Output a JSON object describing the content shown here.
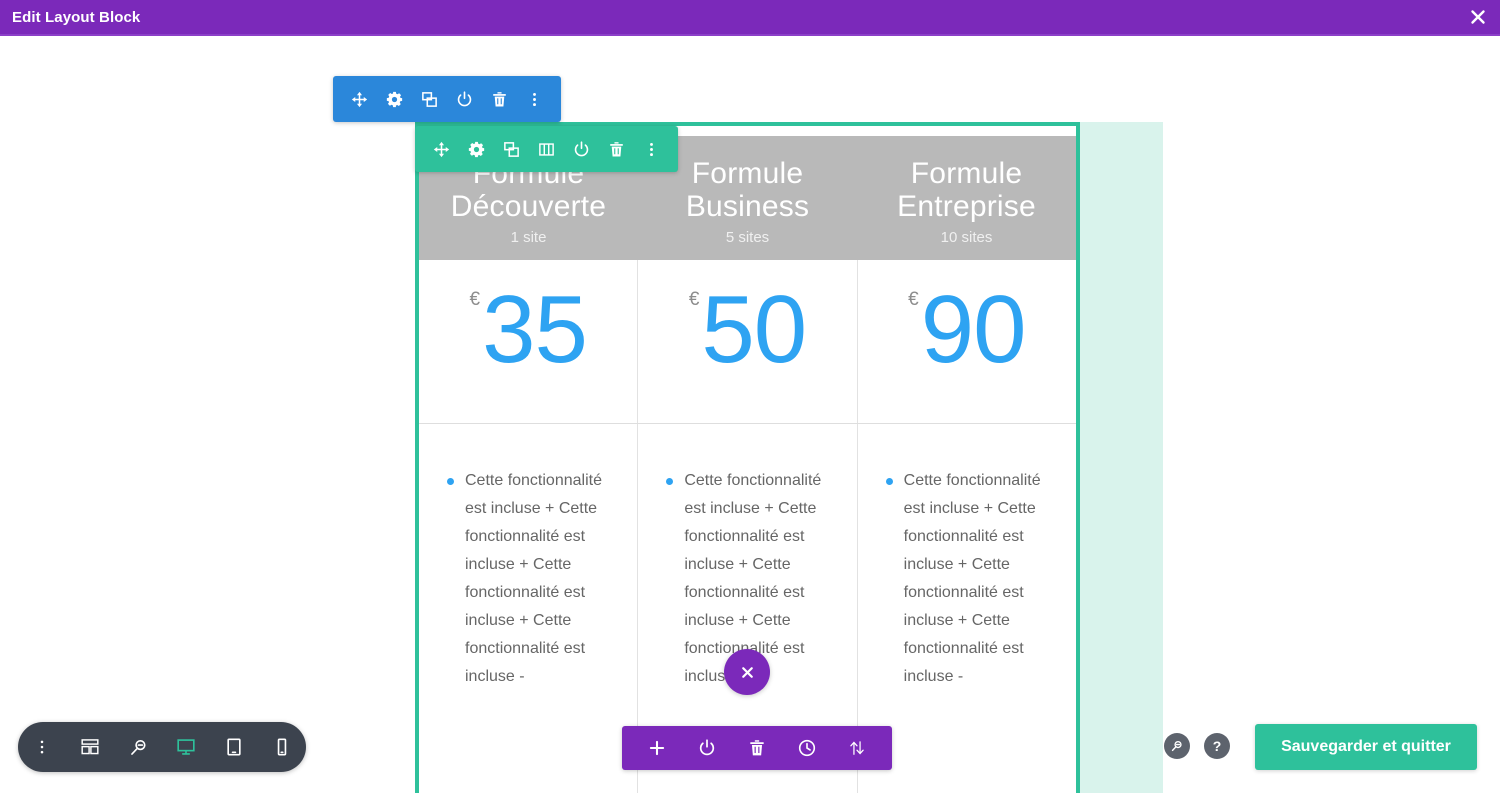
{
  "window": {
    "title": "Edit Layout Block",
    "close_icon": "close-icon",
    "accent": "#7b29ba"
  },
  "row_toolbar": {
    "color": "#2b87da",
    "buttons": [
      {
        "icon": "move-icon",
        "label": "Move row"
      },
      {
        "icon": "gear-icon",
        "label": "Row settings"
      },
      {
        "icon": "duplicate-icon",
        "label": "Duplicate row"
      },
      {
        "icon": "power-icon",
        "label": "Disable row"
      },
      {
        "icon": "trash-icon",
        "label": "Delete row"
      },
      {
        "icon": "more-vertical-icon",
        "label": "More options"
      }
    ]
  },
  "column_toolbar": {
    "color": "#2ec19b",
    "buttons": [
      {
        "icon": "move-icon",
        "label": "Move section"
      },
      {
        "icon": "gear-icon",
        "label": "Section settings"
      },
      {
        "icon": "duplicate-icon",
        "label": "Duplicate section"
      },
      {
        "icon": "columns-icon",
        "label": "Column structure"
      },
      {
        "icon": "power-icon",
        "label": "Disable section"
      },
      {
        "icon": "trash-icon",
        "label": "Delete section"
      },
      {
        "icon": "more-vertical-icon",
        "label": "More options"
      }
    ]
  },
  "module_toolbar": {
    "color": "#7b29ba",
    "close_icon": "close-icon",
    "buttons": [
      {
        "icon": "plus-icon",
        "label": "Add module"
      },
      {
        "icon": "power-icon",
        "label": "Disable module"
      },
      {
        "icon": "trash-icon",
        "label": "Delete module"
      },
      {
        "icon": "history-icon",
        "label": "Editing history"
      },
      {
        "icon": "sort-icon",
        "label": "Reorder"
      }
    ]
  },
  "bottom_toolbar": {
    "color": "#3c434e",
    "active_color": "#2ec19b",
    "buttons": [
      {
        "icon": "more-vertical-icon",
        "label": "More settings",
        "active": false
      },
      {
        "icon": "wireframe-icon",
        "label": "Wireframe view",
        "active": false
      },
      {
        "icon": "zoom-out-icon",
        "label": "Zoom out",
        "active": false
      },
      {
        "icon": "desktop-icon",
        "label": "Desktop view",
        "active": true
      },
      {
        "icon": "tablet-icon",
        "label": "Tablet view",
        "active": false
      },
      {
        "icon": "phone-icon",
        "label": "Phone view",
        "active": false
      }
    ]
  },
  "bottom_right": {
    "zoom_icon": "zoom-out-icon",
    "help_icon": "help-icon",
    "help_glyph": "?",
    "save_label": "Sauvegarder et quitter",
    "save_color": "#2ec19b"
  },
  "pricing": {
    "header_bg": "#b9b9b9",
    "price_color": "#2ea3f2",
    "currency_symbol": "€",
    "bullet_color": "#2ea3f2",
    "tiers": [
      {
        "title": "Formule Découverte",
        "subtitle": "1 site",
        "price": "35",
        "currency": "€",
        "features": [
          "Cette fonctionnalité est incluse + Cette fonctionnalité est incluse + Cette fonctionnalité est incluse + Cette fonctionnalité est incluse -"
        ]
      },
      {
        "title": "Formule Business",
        "subtitle": "5 sites",
        "price": "50",
        "currency": "€",
        "features": [
          "Cette fonctionnalité est incluse + Cette fonctionnalité est incluse + Cette fonctionnalité est incluse + Cette fonctionnalité est incluse -"
        ]
      },
      {
        "title": "Formule Entreprise",
        "subtitle": "10 sites",
        "price": "90",
        "currency": "€",
        "features": [
          "Cette fonctionnalité est incluse + Cette fonctionnalité est incluse + Cette fonctionnalité est incluse + Cette fonctionnalité est incluse -"
        ]
      }
    ]
  }
}
